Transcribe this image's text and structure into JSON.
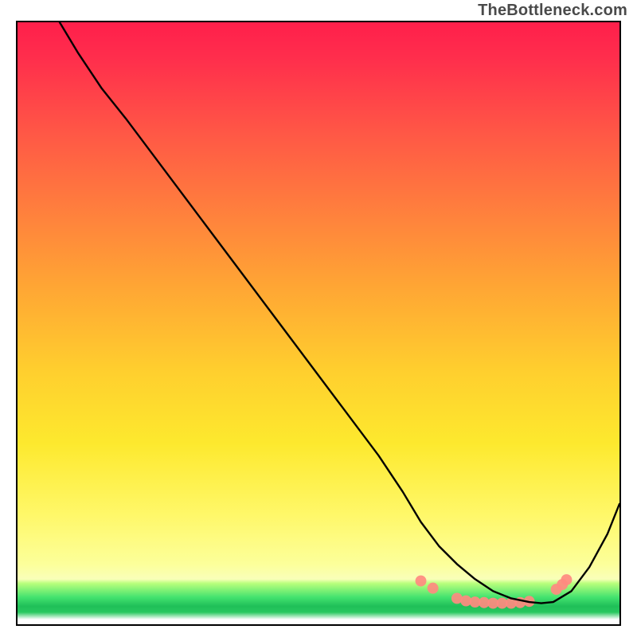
{
  "watermark": "TheBottleneck.com",
  "chart_data": {
    "type": "line",
    "title": "",
    "xlabel": "",
    "ylabel": "",
    "xlim": [
      0,
      100
    ],
    "ylim": [
      0,
      100
    ],
    "grid": false,
    "legend": false,
    "background_gradient": {
      "orientation": "vertical",
      "stops": [
        {
          "pos": 0.0,
          "color": "#ff1f4b"
        },
        {
          "pos": 0.18,
          "color": "#ff5646"
        },
        {
          "pos": 0.44,
          "color": "#ffa634"
        },
        {
          "pos": 0.7,
          "color": "#fde92e"
        },
        {
          "pos": 0.9,
          "color": "#fcff9a"
        },
        {
          "pos": 0.955,
          "color": "#44e36f"
        },
        {
          "pos": 0.992,
          "color": "#ffffff"
        }
      ]
    },
    "series": [
      {
        "name": "bottleneck-curve",
        "color": "#000000",
        "x": [
          7,
          10,
          14,
          18,
          24,
          30,
          36,
          42,
          48,
          54,
          60,
          64,
          67,
          70,
          73,
          76,
          79,
          82,
          85,
          87,
          89,
          92,
          95,
          98,
          100
        ],
        "y": [
          100,
          95,
          89,
          84,
          76,
          68,
          60,
          52,
          44,
          36,
          28,
          22,
          17,
          13,
          10,
          7.5,
          5.5,
          4.3,
          3.7,
          3.5,
          3.7,
          5.5,
          9.5,
          15,
          20
        ]
      }
    ],
    "markers": [
      {
        "name": "highlight-dots",
        "color": "#ff8a80",
        "radius": 7,
        "points": [
          {
            "x": 67,
            "y": 7.2
          },
          {
            "x": 69,
            "y": 6.0
          },
          {
            "x": 73,
            "y": 4.3
          },
          {
            "x": 74.5,
            "y": 3.9
          },
          {
            "x": 76,
            "y": 3.7
          },
          {
            "x": 77.5,
            "y": 3.6
          },
          {
            "x": 79,
            "y": 3.5
          },
          {
            "x": 80.5,
            "y": 3.5
          },
          {
            "x": 82,
            "y": 3.5
          },
          {
            "x": 83.5,
            "y": 3.6
          },
          {
            "x": 85,
            "y": 3.8
          },
          {
            "x": 89.5,
            "y": 5.8
          },
          {
            "x": 90.5,
            "y": 6.6
          },
          {
            "x": 91.2,
            "y": 7.4
          }
        ]
      }
    ]
  }
}
